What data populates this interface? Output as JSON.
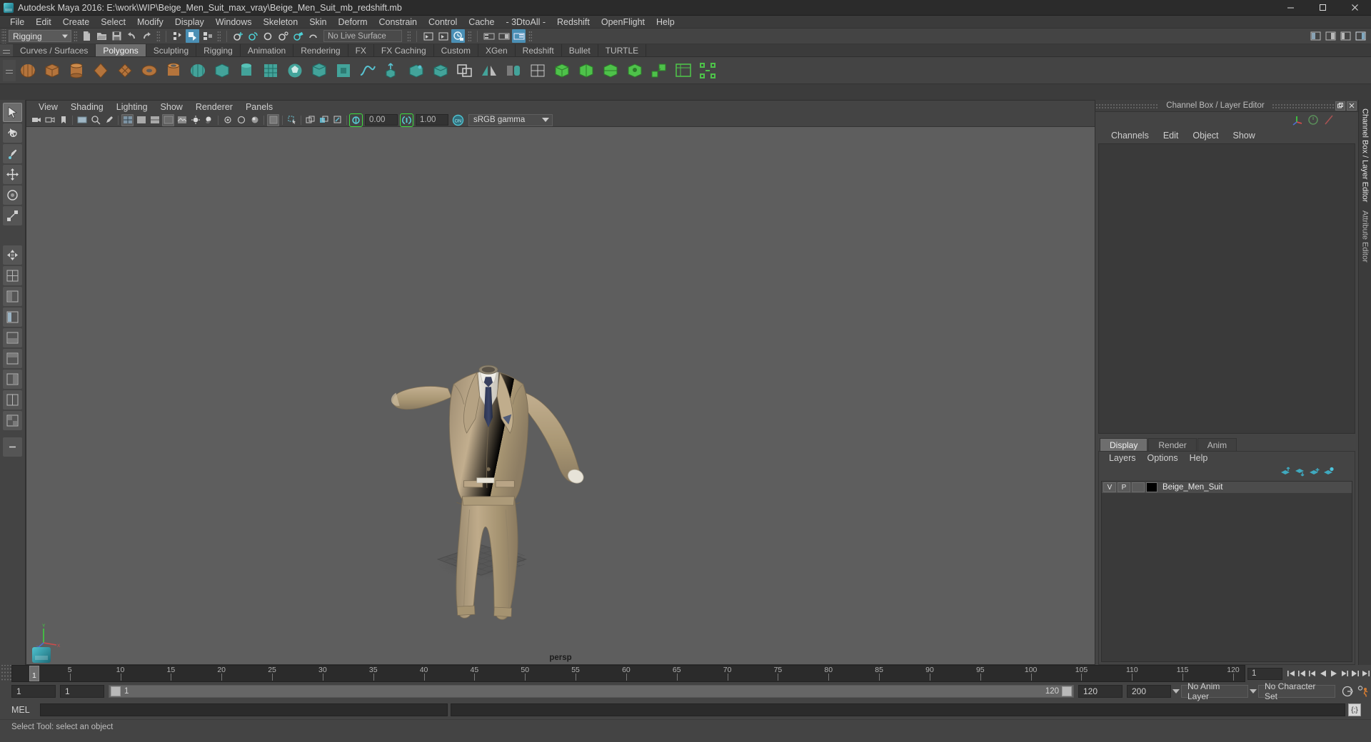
{
  "window": {
    "title": "Autodesk Maya 2016: E:\\work\\WIP\\Beige_Men_Suit_max_vray\\Beige_Men_Suit_mb_redshift.mb",
    "minimize": "─",
    "maximize": "❐",
    "close": "✕"
  },
  "menubar": {
    "items": [
      {
        "label": "File"
      },
      {
        "label": "Edit"
      },
      {
        "label": "Create"
      },
      {
        "label": "Select"
      },
      {
        "label": "Modify"
      },
      {
        "label": "Display"
      },
      {
        "label": "Windows"
      },
      {
        "label": "Skeleton"
      },
      {
        "label": "Skin"
      },
      {
        "label": "Deform"
      },
      {
        "label": "Constrain"
      },
      {
        "label": "Control"
      },
      {
        "label": "Cache"
      },
      {
        "label": "- 3DtoAll -"
      },
      {
        "label": "Redshift"
      },
      {
        "label": "OpenFlight"
      },
      {
        "label": "Help"
      }
    ]
  },
  "toolbar": {
    "menuset": "Rigging",
    "live_surface": "No Live Surface"
  },
  "shelf": {
    "tabs": [
      {
        "label": "Curves / Surfaces",
        "active": false
      },
      {
        "label": "Polygons",
        "active": true
      },
      {
        "label": "Sculpting",
        "active": false
      },
      {
        "label": "Rigging",
        "active": false
      },
      {
        "label": "Animation",
        "active": false
      },
      {
        "label": "Rendering",
        "active": false
      },
      {
        "label": "FX",
        "active": false
      },
      {
        "label": "FX Caching",
        "active": false
      },
      {
        "label": "Custom",
        "active": false
      },
      {
        "label": "XGen",
        "active": false
      },
      {
        "label": "Redshift",
        "active": false
      },
      {
        "label": "Bullet",
        "active": false
      },
      {
        "label": "TURTLE",
        "active": false
      }
    ]
  },
  "viewport": {
    "menus": [
      {
        "label": "View"
      },
      {
        "label": "Shading"
      },
      {
        "label": "Lighting"
      },
      {
        "label": "Show"
      },
      {
        "label": "Renderer"
      },
      {
        "label": "Panels"
      }
    ],
    "exposure": "0.00",
    "gamma_value": "1.00",
    "color_management": "sRGB gamma",
    "camera_label": "persp",
    "toggle_on_label": "ON"
  },
  "channelbox": {
    "panel_title": "Channel Box / Layer Editor",
    "menus": [
      {
        "label": "Channels"
      },
      {
        "label": "Edit"
      },
      {
        "label": "Object"
      },
      {
        "label": "Show"
      }
    ]
  },
  "layer_editor": {
    "tabs": [
      {
        "label": "Display",
        "active": true
      },
      {
        "label": "Render",
        "active": false
      },
      {
        "label": "Anim",
        "active": false
      }
    ],
    "menus": [
      {
        "label": "Layers"
      },
      {
        "label": "Options"
      },
      {
        "label": "Help"
      }
    ],
    "columns": {
      "visible": "V",
      "playback": "P"
    },
    "rows": [
      {
        "visible": "V",
        "playback": "P",
        "color": "#000000",
        "name": "Beige_Men_Suit"
      }
    ]
  },
  "vertical_tabs": [
    {
      "label": "Channel Box / Layer Editor",
      "active": true
    },
    {
      "label": "Attribute Editor",
      "active": false
    }
  ],
  "timeline": {
    "ticks": [
      5,
      10,
      15,
      20,
      25,
      30,
      35,
      40,
      45,
      50,
      55,
      60,
      65,
      70,
      75,
      80,
      85,
      90,
      95,
      100,
      105,
      110,
      115,
      120
    ],
    "start": 1,
    "end": 120,
    "current_frame": "1",
    "current_frame_field": "1"
  },
  "range": {
    "anim_start": "1",
    "range_start": "1",
    "slider_label_left": "1",
    "slider_label_right": "120",
    "range_end": "120",
    "anim_end": "200",
    "anim_layer": "No Anim Layer",
    "character_set": "No Character Set"
  },
  "command_line": {
    "label": "MEL",
    "input_value": "",
    "script_editor_glyph": "{;}"
  },
  "status": {
    "message": "Select Tool: select an object"
  },
  "colors": {
    "accent_blue": "#4a8fb5",
    "highlight_green": "#3ee03e",
    "panel_bg": "#444444",
    "dark_bg": "#2b2b2b",
    "suit_beige": "#b9a487"
  }
}
